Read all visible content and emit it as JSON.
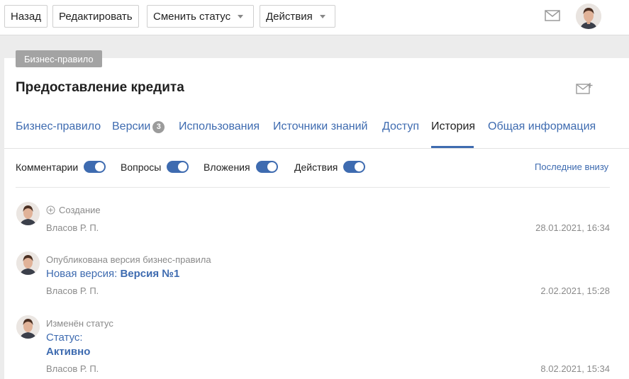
{
  "toolbar": {
    "back_label": "Назад",
    "edit_label": "Редактировать",
    "change_status_label": "Сменить статус",
    "actions_label": "Действия",
    "mail_icon": "mail-icon",
    "avatar_icon": "user-avatar"
  },
  "card": {
    "badge": "Бизнес-правило",
    "title": "Предоставление кредита",
    "subscribe_icon": "mail-plus-icon"
  },
  "tabs": [
    {
      "label": "Бизнес-правило"
    },
    {
      "label": "Версии",
      "count": "3"
    },
    {
      "label": "Использования"
    },
    {
      "label": "Источники знаний"
    },
    {
      "label": "Доступ"
    },
    {
      "label": "История",
      "active": true
    },
    {
      "label": "Общая информация"
    }
  ],
  "filters": {
    "comments": "Комментарии",
    "questions": "Вопросы",
    "attachments": "Вложения",
    "actions": "Действия",
    "sort_label": "Последние внизу"
  },
  "history": [
    {
      "head": "Создание",
      "author": "Власов Р. П.",
      "date": "28.01.2021, 16:34"
    },
    {
      "head": "Опубликована версия бизнес-правила",
      "body_prefix": "Новая версия: ",
      "body_value": "Версия №1",
      "author": "Власов Р. П.",
      "date": "2.02.2021, 15:28"
    },
    {
      "head": "Изменён статус",
      "body_prefix": "Статус:",
      "body_value": "Активно",
      "author": "Власов Р. П.",
      "date": "8.02.2021, 15:34"
    }
  ],
  "colors": {
    "accent": "#3e6bb0",
    "badge_bg": "#a3a3a3",
    "muted_text": "#8a8a8a"
  }
}
